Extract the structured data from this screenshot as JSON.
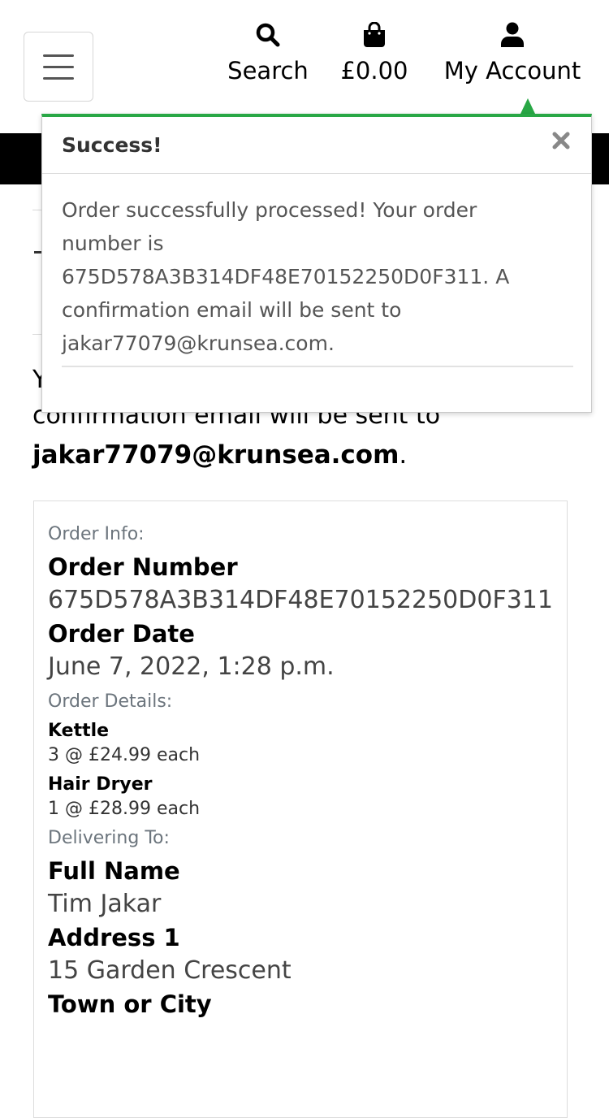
{
  "header": {
    "menu_toggle_label": "",
    "search_label": "Search",
    "bag_total": "£0.00",
    "account_label": "My Account"
  },
  "toast": {
    "title": "Success!",
    "message_lines": [
      "Order successfully processed! Your order",
      "number is",
      "675D578A3B314DF48E70152250D0F311. A",
      "confirmation email will be sent to",
      "jakar77079@krunsea.com."
    ],
    "accent_color": "#28a745"
  },
  "page": {
    "confirmation_partial": "confirmation email will be sent to",
    "email": "jakar77079@krunsea.com",
    "email_suffix": "."
  },
  "order": {
    "info_label": "Order Info:",
    "number_title": "Order Number",
    "number_value": "675D578A3B314DF48E70152250D0F311",
    "date_title": "Order Date",
    "date_value": "June 7, 2022, 1:28 p.m.",
    "details_label": "Order Details:",
    "items": [
      {
        "name": "Kettle",
        "qty_line": "3 @ £24.99 each"
      },
      {
        "name": "Hair Dryer",
        "qty_line": "1 @ £28.99 each"
      }
    ],
    "delivering_label": "Delivering To:",
    "full_name_title": "Full Name",
    "full_name_value": "Tim Jakar",
    "address1_title": "Address 1",
    "address1_value": "15 Garden Crescent",
    "town_title": "Town or City"
  }
}
